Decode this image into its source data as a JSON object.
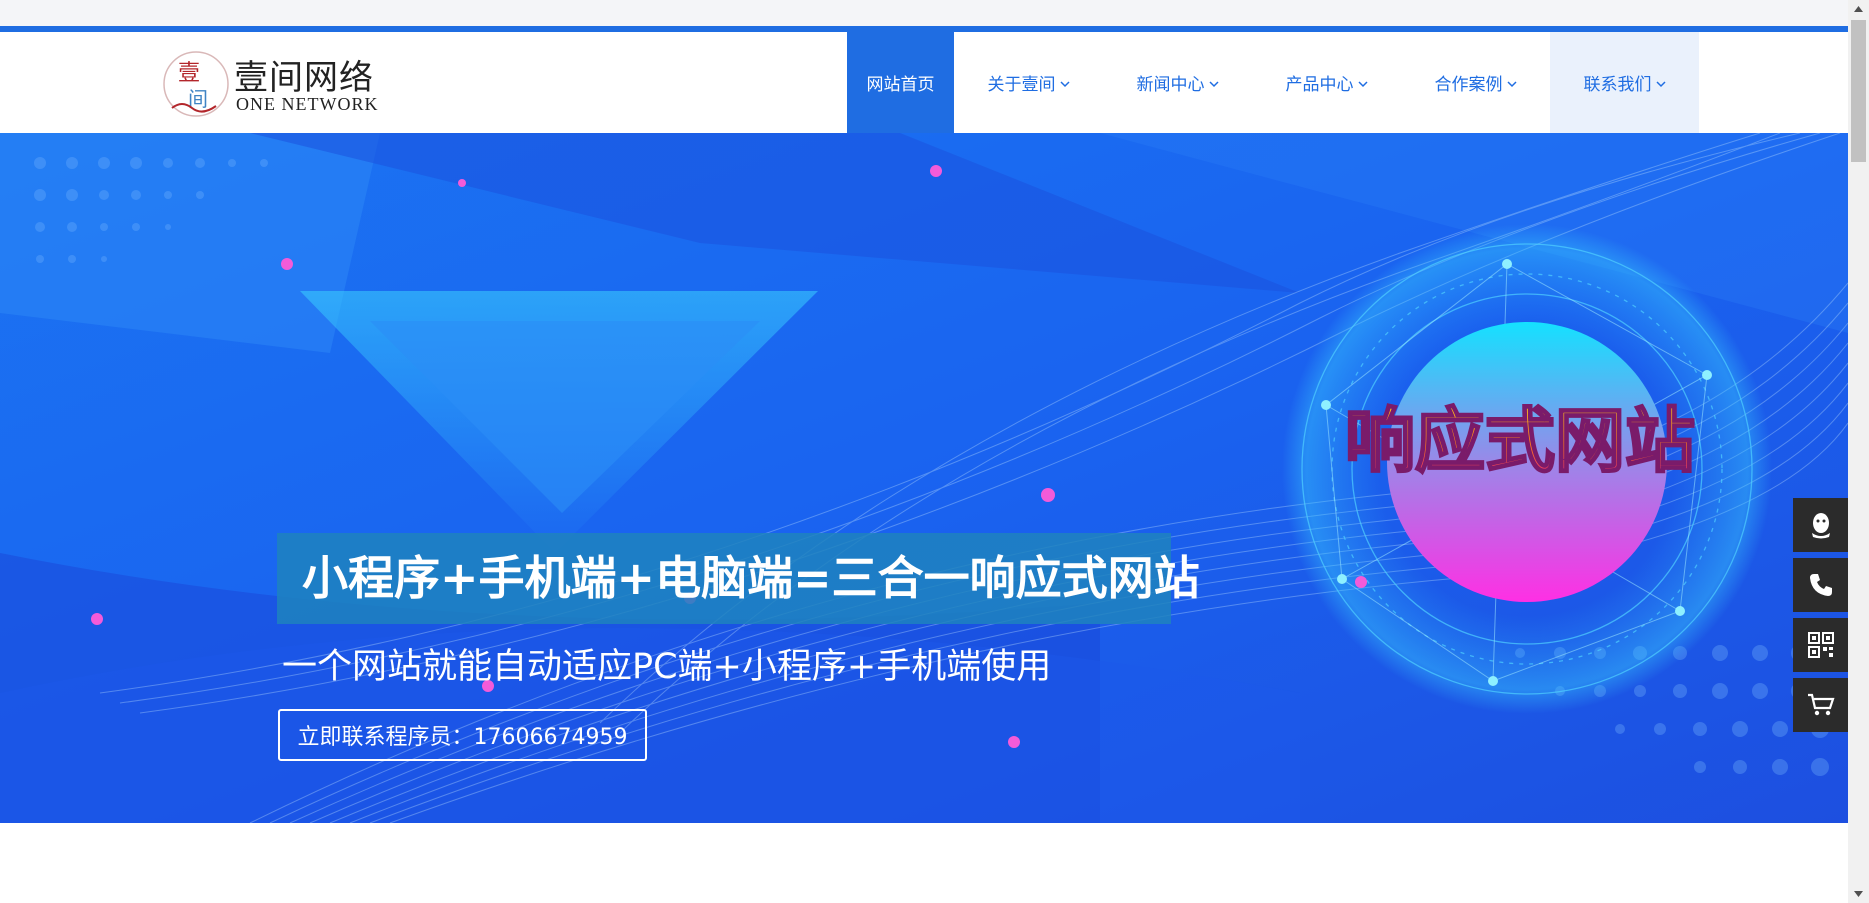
{
  "logo": {
    "name_cn": "壹间网络",
    "name_en": "ONE NETWORK",
    "seal_chars": [
      "壹",
      "间"
    ]
  },
  "nav": {
    "items": [
      {
        "label": "网站首页",
        "has_dropdown": false,
        "state": "active"
      },
      {
        "label": "关于壹间",
        "has_dropdown": true,
        "state": "normal"
      },
      {
        "label": "新闻中心",
        "has_dropdown": true,
        "state": "normal"
      },
      {
        "label": "产品中心",
        "has_dropdown": true,
        "state": "normal"
      },
      {
        "label": "合作案例",
        "has_dropdown": true,
        "state": "normal"
      },
      {
        "label": "联系我们",
        "has_dropdown": true,
        "state": "hover"
      }
    ],
    "chevron": "⌄"
  },
  "banner": {
    "title": "小程序+手机端+电脑端=三合一响应式网站",
    "subtitle": "一个网站就能自动适应PC端+小程序+手机端使用",
    "button_label": "立即联系程序员：17606674959",
    "emblem_text": "响应式网站",
    "slides": 3,
    "active_slide": 2
  },
  "tools": [
    {
      "icon": "qq-icon"
    },
    {
      "icon": "phone-icon"
    },
    {
      "icon": "qr-code-icon"
    },
    {
      "icon": "cart-icon"
    }
  ],
  "colors": {
    "primary": "#1f6de2",
    "banner_bg": "#1a5cf0",
    "tool_bg": "#2b2b2b"
  }
}
